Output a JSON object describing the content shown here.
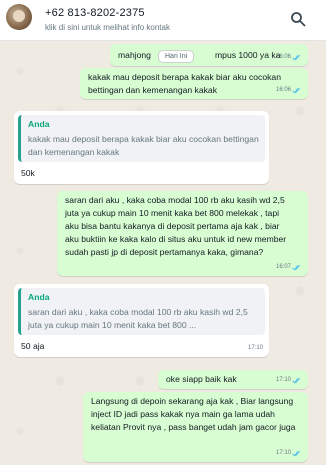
{
  "header": {
    "contact_phone": "+62 813-8202-2375",
    "contact_subtitle": "klik di sini untuk melihat info kontak",
    "search_icon": "search-icon"
  },
  "date_chip": "Hari Ini",
  "messages": [
    {
      "dir": "out",
      "text_left": "mahjong",
      "text_right": "mpus 1000 ya ka",
      "time": "16:06",
      "status": "read"
    },
    {
      "dir": "out",
      "text": "kakak mau deposit berapa kakak biar aku cocokan bettingan dan kemenangan kakak",
      "time": "16:06",
      "status": "read"
    },
    {
      "dir": "in",
      "quote_author": "Anda",
      "quote_text": "kakak mau deposit berapa kakak biar aku cocokan bettingan dan kemenangan kakak",
      "text": "50k"
    },
    {
      "dir": "out",
      "text": "saran dari aku , kaka coba modal 100 rb aku kasih wd 2,5 juta ya cukup main 10 menit kaka bet 800 melekak , tapi aku bisa bantu kakanya di deposit pertama aja kak , biar aku buktiin ke kaka kalo di situs aku untuk id new member sudah pasti jp di deposit pertamanya kaka, gimana?",
      "time": "16:07",
      "status": "read"
    },
    {
      "dir": "in",
      "quote_author": "Anda",
      "quote_text": "saran dari aku , kaka coba modal 100 rb aku kasih wd 2,5 juta ya cukup main 10 menit kaka bet 800 ...",
      "text": "50 aja",
      "time": "17:10"
    },
    {
      "dir": "out",
      "text": "oke siapp baik kak",
      "time": "17:10",
      "status": "read"
    },
    {
      "dir": "out",
      "text": "Langsung di depoin sekarang aja kak , Biar langsung inject ID jadi pass kakak nya main ga lama udah keliatan Provit nya , pass banget udah jam gacor juga",
      "time": "17:10",
      "status": "read"
    }
  ],
  "colors": {
    "outgoing_bubble": "#d9fdd3",
    "incoming_bubble": "#ffffff",
    "quote_accent": "#06a77d",
    "read_ticks": "#53bdeb"
  }
}
